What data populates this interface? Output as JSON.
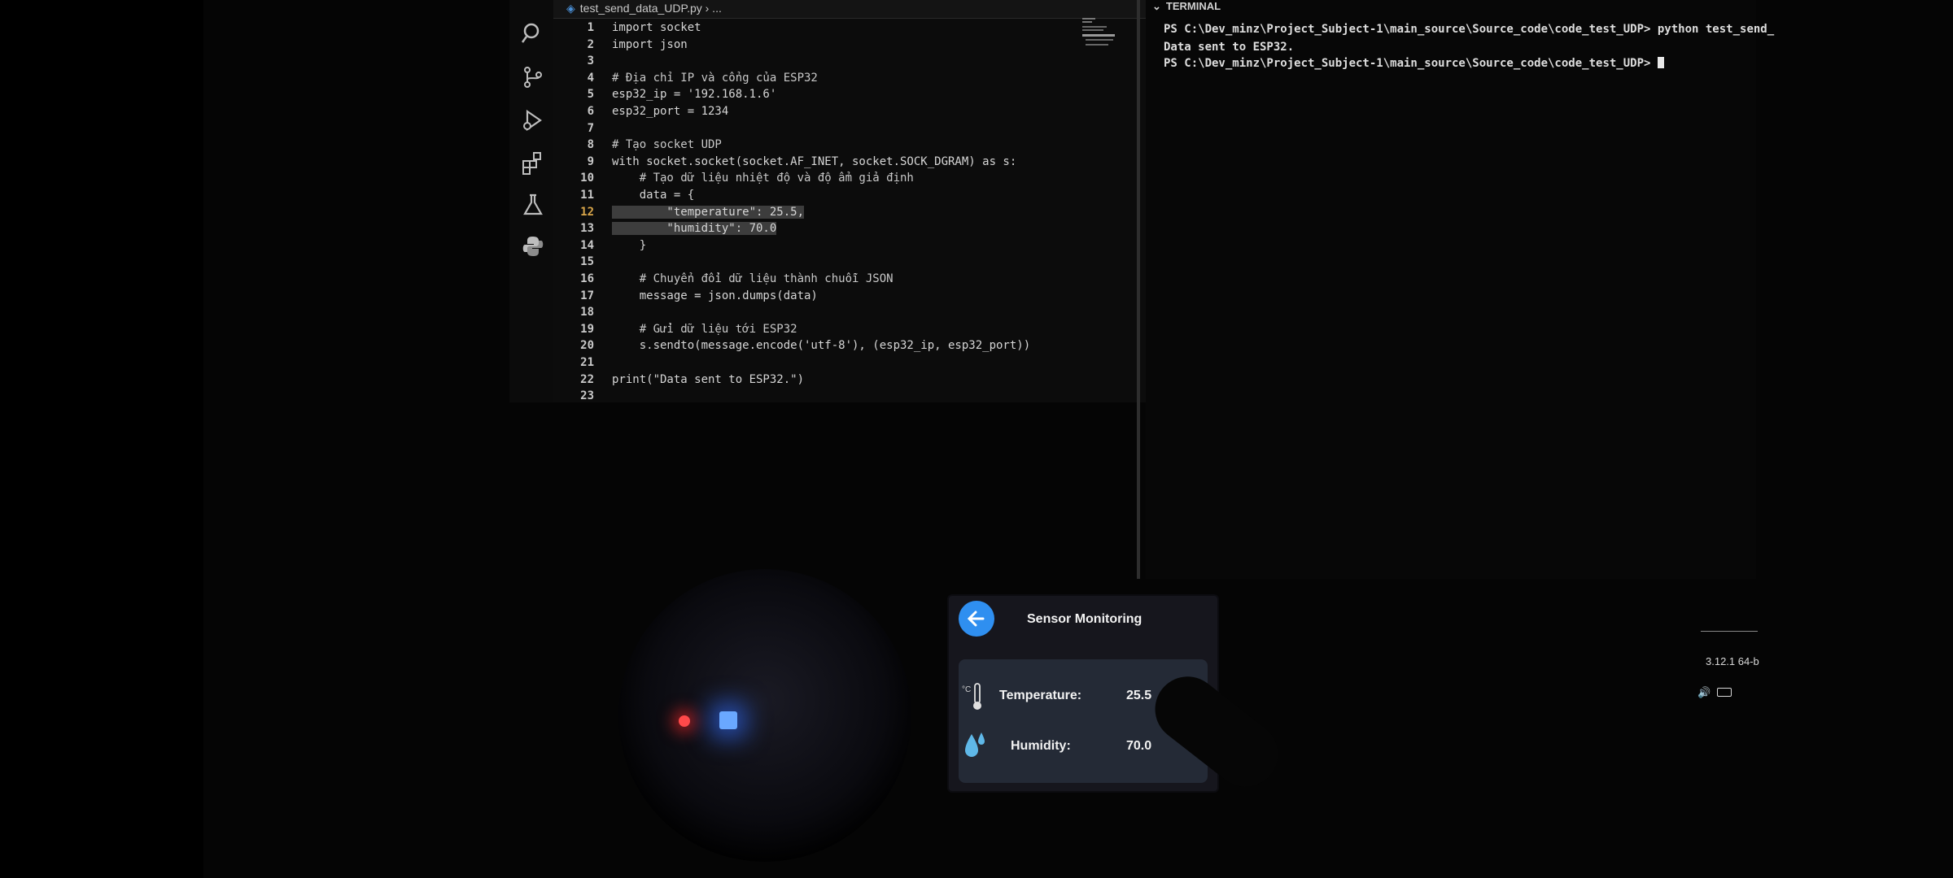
{
  "editor": {
    "tab_label": "test_send_data_UDP.py › ...",
    "lines": [
      {
        "n": "1",
        "text": "import socket"
      },
      {
        "n": "2",
        "text": "import json"
      },
      {
        "n": "3",
        "text": ""
      },
      {
        "n": "4",
        "text": "# Địa chỉ IP và cổng của ESP32"
      },
      {
        "n": "5",
        "text": "esp32_ip = '192.168.1.6'"
      },
      {
        "n": "6",
        "text": "esp32_port = 1234"
      },
      {
        "n": "7",
        "text": ""
      },
      {
        "n": "8",
        "text": "# Tạo socket UDP"
      },
      {
        "n": "9",
        "text": "with socket.socket(socket.AF_INET, socket.SOCK_DGRAM) as s:"
      },
      {
        "n": "10",
        "text": "    # Tạo dữ liệu nhiệt độ và độ ẩm giả định"
      },
      {
        "n": "11",
        "text": "    data = {"
      },
      {
        "n": "12",
        "text": "        \"temperature\": 25.5,"
      },
      {
        "n": "13",
        "text": "        \"humidity\": 70.0"
      },
      {
        "n": "14",
        "text": "    }"
      },
      {
        "n": "15",
        "text": ""
      },
      {
        "n": "16",
        "text": "    # Chuyển đổi dữ liệu thành chuỗi JSON"
      },
      {
        "n": "17",
        "text": "    message = json.dumps(data)"
      },
      {
        "n": "18",
        "text": ""
      },
      {
        "n": "19",
        "text": "    # Gửi dữ liệu tới ESP32"
      },
      {
        "n": "20",
        "text": "    s.sendto(message.encode('utf-8'), (esp32_ip, esp32_port))"
      },
      {
        "n": "21",
        "text": ""
      },
      {
        "n": "22",
        "text": "print(\"Data sent to ESP32.\")"
      },
      {
        "n": "23",
        "text": ""
      }
    ]
  },
  "terminal": {
    "header": "TERMINAL",
    "lines": [
      "PS C:\\Dev_minz\\Project_Subject-1\\main_source\\Source_code\\code_test_UDP> python test_send_",
      "Data sent to ESP32.",
      "PS C:\\Dev_minz\\Project_Subject-1\\main_source\\Source_code\\code_test_UDP> "
    ],
    "python_version": "3.12.1 64-b"
  },
  "device": {
    "title": "Sensor Monitoring",
    "temperature_label": "Temperature:",
    "temperature_value": "25.5",
    "humidity_label": "Humidity:",
    "humidity_value": "70.0"
  },
  "colors": {
    "accent": "#2f8ff0",
    "panel": "#242a36",
    "led_red": "#ff4a4a",
    "led_blue": "#6aa8ff"
  }
}
